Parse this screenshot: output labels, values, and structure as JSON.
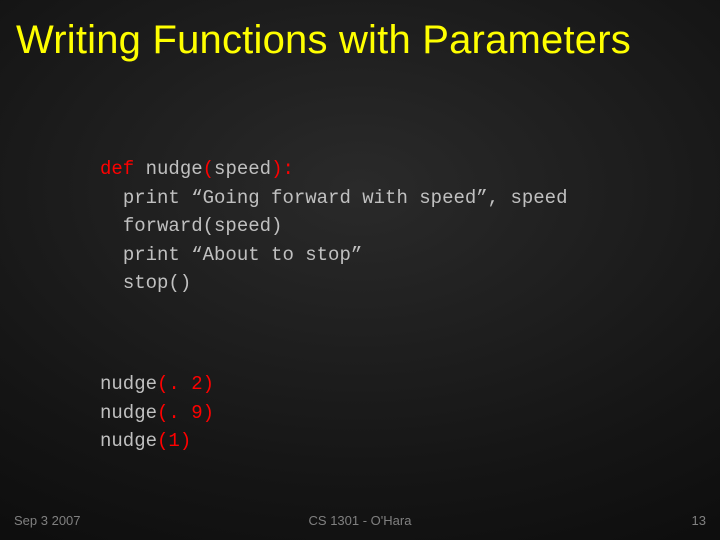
{
  "title": "Writing Functions with Parameters",
  "code": {
    "def_kw": "def",
    "def_name": " nudge",
    "def_paren_open": "(",
    "def_param": "speed",
    "def_paren_close": ")",
    "def_colon": ":",
    "line2": "print “Going forward with speed”, speed",
    "line3": "forward(speed)",
    "line4": "print “About to stop”",
    "line5": "stop()",
    "call1_name": "nudge",
    "call1_args": "(. 2)",
    "call2_name": "nudge",
    "call2_args": "(. 9)",
    "call3_name": "nudge",
    "call3_args": "(1)"
  },
  "footer": {
    "left": "Sep 3 2007",
    "center": "CS 1301 - O'Hara",
    "right": "13"
  }
}
